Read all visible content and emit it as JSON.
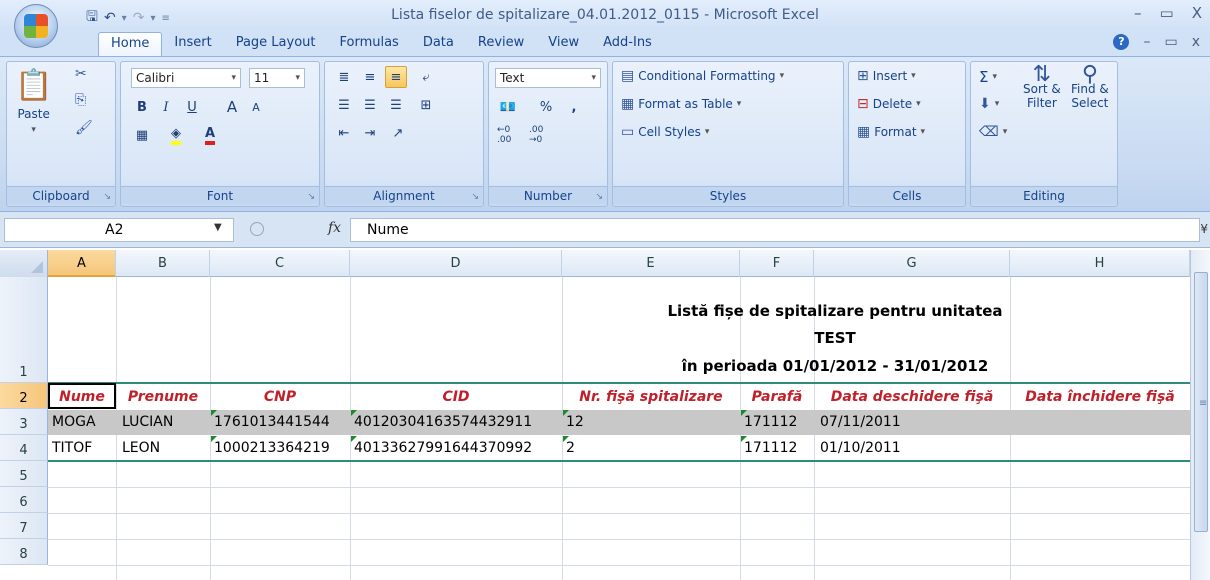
{
  "window": {
    "title": "Lista fiselor de spitalizare_04.01.2012_0115 - Microsoft Excel",
    "minimize": "–",
    "maximize": "▭",
    "close": "X"
  },
  "ribbon_tabs": [
    "Home",
    "Insert",
    "Page Layout",
    "Formulas",
    "Data",
    "Review",
    "View",
    "Add-Ins"
  ],
  "clipboard": {
    "paste": "Paste",
    "label": "Clipboard"
  },
  "font": {
    "name": "Calibri",
    "size": "11",
    "label": "Font",
    "bold": "B",
    "italic": "I",
    "underline": "U",
    "grow": "A",
    "shrink": "A",
    "color_letter": "A"
  },
  "alignment": {
    "label": "Alignment"
  },
  "number": {
    "format": "Text",
    "percent": "%",
    "comma": ",",
    "inc": "←0 .00",
    "dec": ".00 →0",
    "label": "Number"
  },
  "styles": {
    "conditional": "Conditional Formatting",
    "format_table": "Format as Table",
    "cell_styles": "Cell Styles",
    "label": "Styles"
  },
  "cells": {
    "insert": "Insert",
    "delete": "Delete",
    "format": "Format",
    "label": "Cells"
  },
  "editing": {
    "sum": "Σ",
    "sort": "Sort &",
    "filter": "Filter",
    "find": "Find &",
    "select": "Select",
    "label": "Editing"
  },
  "formula_bar": {
    "name_box": "A2",
    "fx": "fx",
    "value": "Nume"
  },
  "columns": [
    "A",
    "B",
    "C",
    "D",
    "E",
    "F",
    "G",
    "H"
  ],
  "rows": [
    "1",
    "2",
    "3",
    "4",
    "5",
    "6",
    "7",
    "8"
  ],
  "sheet": {
    "title_lines": [
      "Listă fișe de spitalizare pentru unitatea",
      "TEST",
      "în perioada 01/01/2012 - 31/01/2012"
    ],
    "headers": [
      "Nume",
      "Prenume",
      "CNP",
      "CID",
      "Nr. fişă spitalizare",
      "Parafă",
      "Data deschidere fişă",
      "Data închidere fişă"
    ],
    "records": [
      {
        "nume": "MOGA",
        "prenume": "LUCIAN",
        "cnp": "1761013441544",
        "cid": "40120304163574432911",
        "nr": "12",
        "parafa": "171112",
        "deschidere": "07/11/2011",
        "inchidere": ""
      },
      {
        "nume": "TITOF",
        "prenume": "LEON",
        "cnp": "1000213364219",
        "cid": "40133627991644370992",
        "nr": "2",
        "parafa": "171112",
        "deschidere": "01/10/2011",
        "inchidere": ""
      }
    ]
  },
  "colors": {
    "header_text": "#c0202a",
    "table_border": "#2e8b7a",
    "selected_row_fill": "#c8c8c8"
  }
}
